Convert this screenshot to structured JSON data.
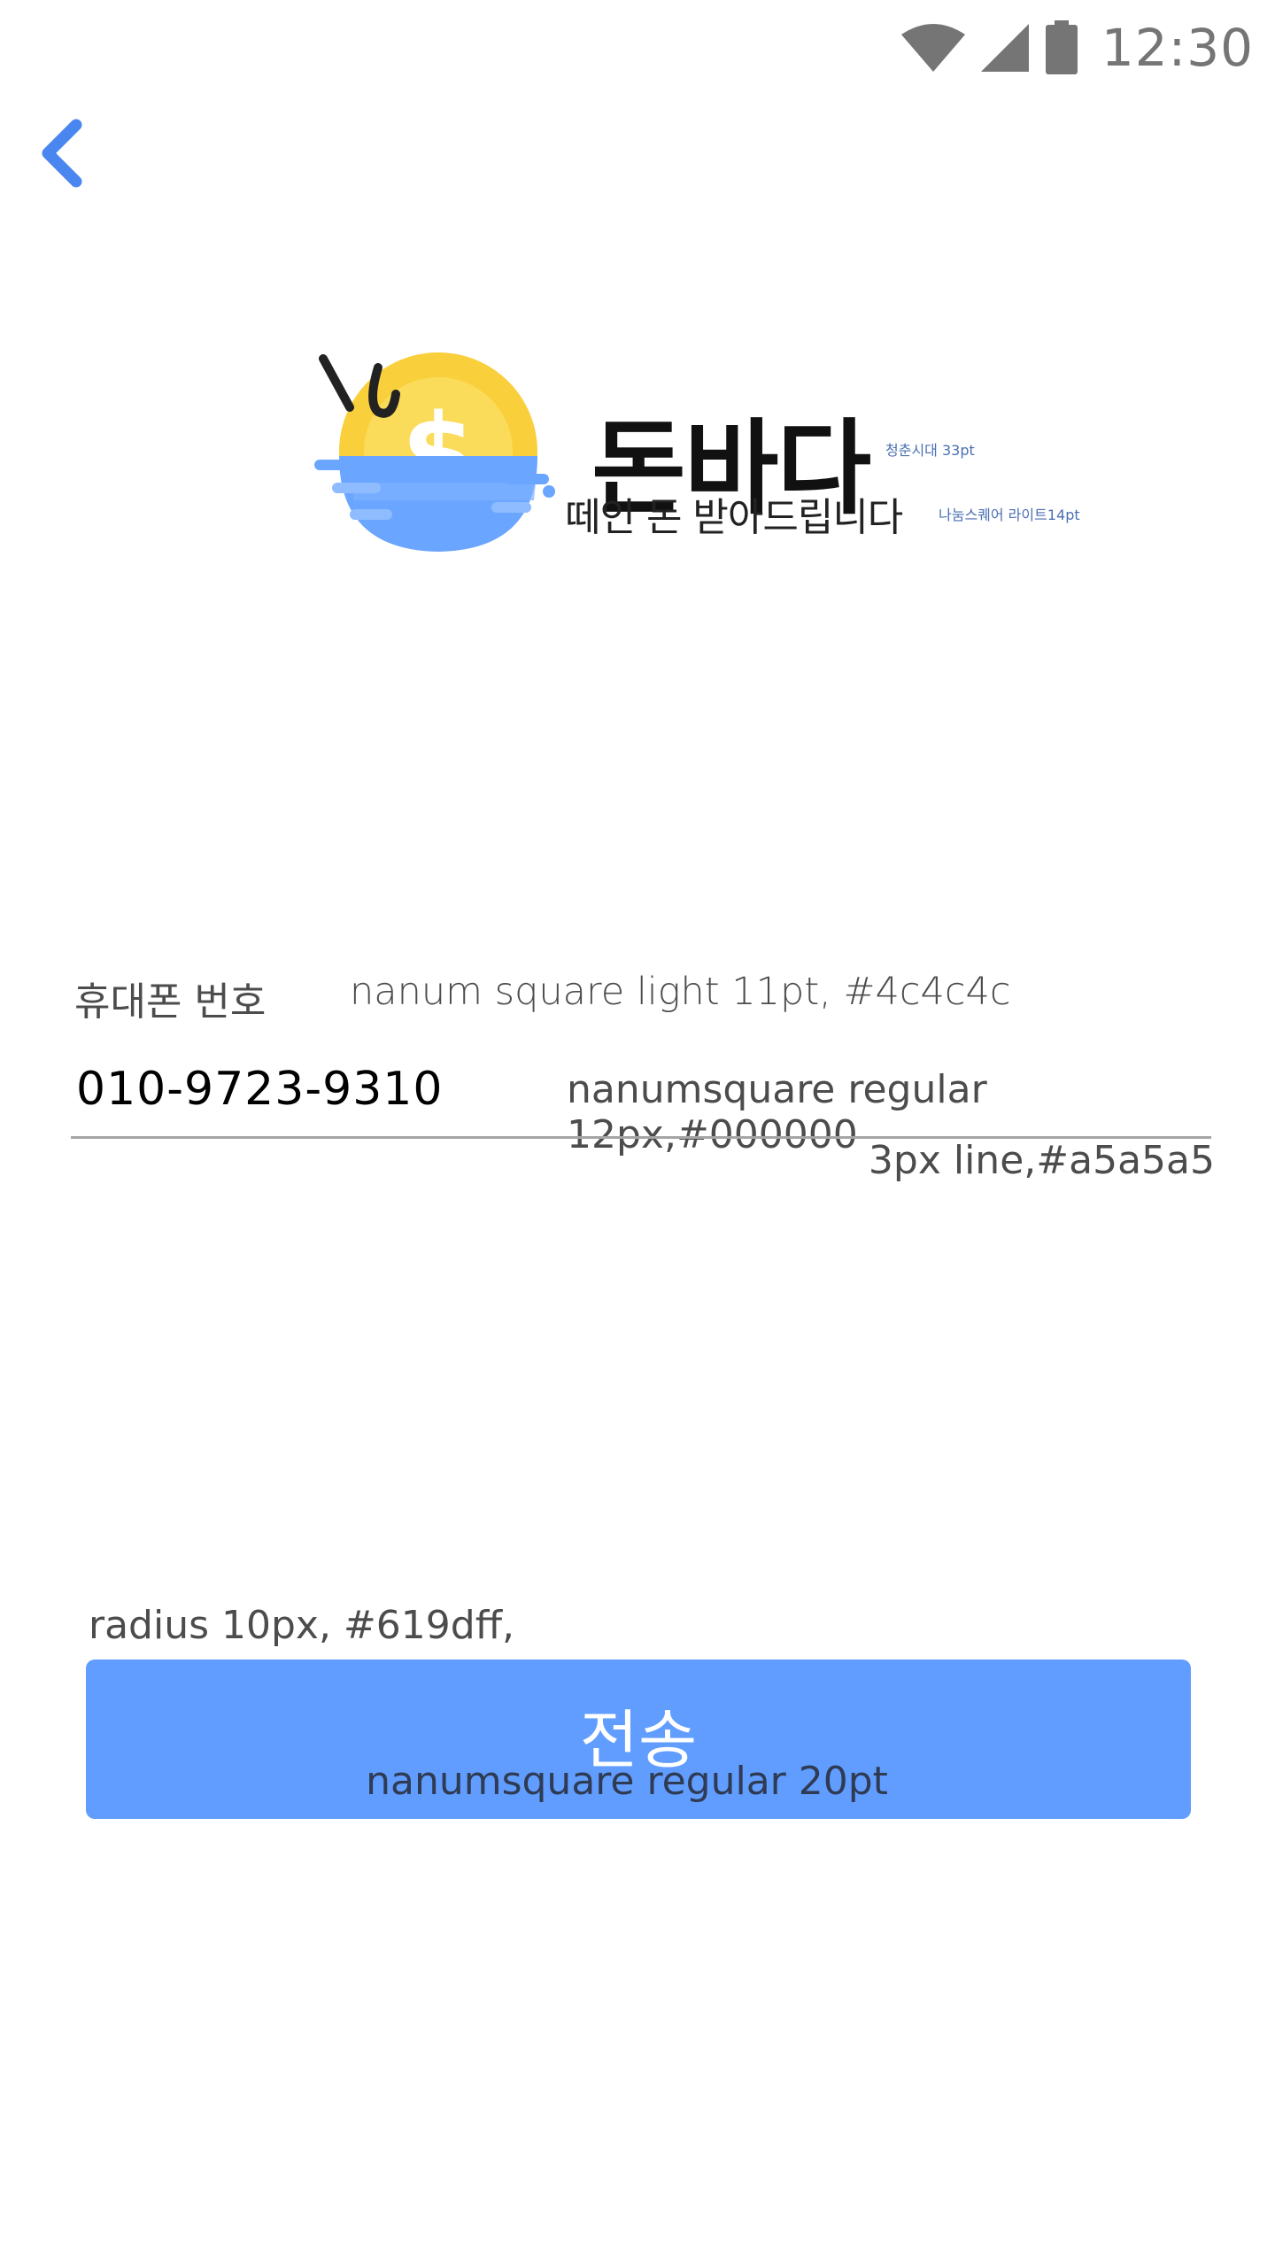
{
  "status_bar": {
    "time": "12:30",
    "icons": [
      "wifi-icon",
      "cellular-signal-icon",
      "battery-icon"
    ],
    "icon_color": "#757575"
  },
  "nav": {
    "back_icon": "chevron-left-icon",
    "accent_color": "#4a86f0"
  },
  "logo": {
    "brand_name": "돈바다",
    "tagline": "떼인 돈 받아드립니다",
    "brand_note": "청춘시대 33pt",
    "tagline_note": "나눔스퀘어 라이트14pt",
    "coin_color": "#f9cf3c",
    "water_color": "#6aa5ff"
  },
  "phone_field": {
    "label": "휴대폰 번호",
    "label_note": "nanum square light 11pt, #4c4c4c",
    "value": "010-9723-9310",
    "value_note": "nanumsquare regular 12px,#000000",
    "line_note": "3px line,#a5a5a5",
    "line_color": "#a5a5a5"
  },
  "send": {
    "note": "radius 10px, #619dff,",
    "label": "전송",
    "label_note": "nanumsquare regular 20pt",
    "color": "#619dff"
  }
}
